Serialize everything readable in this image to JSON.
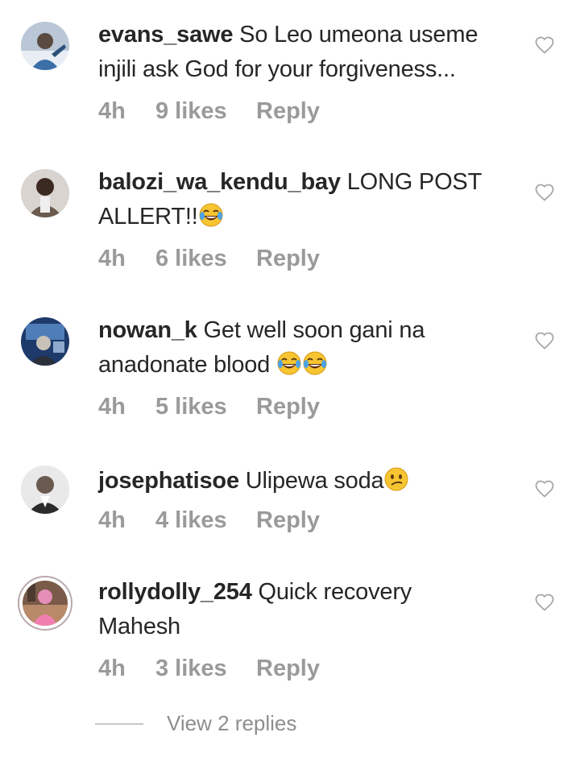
{
  "comments": [
    {
      "username": "evans_sawe",
      "text": "So Leo umeona useme injili ask God for your forgiveness...",
      "line2": "",
      "time": "4h",
      "likes": "9 likes",
      "reply": "Reply",
      "avatar": "avatar-photo"
    },
    {
      "username": "balozi_wa_kendu_bay",
      "text": "LONG POST",
      "line2": "ALLERT!!",
      "time": "4h",
      "likes": "6 likes",
      "reply": "Reply",
      "avatar": "avatar-photo"
    },
    {
      "username": "nowan_k",
      "text": "Get well soon gani na",
      "line2": "anadonate blood",
      "time": "4h",
      "likes": "5 likes",
      "reply": "Reply",
      "avatar": "avatar-photo"
    },
    {
      "username": "josephatisoe",
      "text": "Ulipewa soda",
      "line2": "",
      "time": "4h",
      "likes": "4 likes",
      "reply": "Reply",
      "avatar": "avatar-photo"
    },
    {
      "username": "rollydolly_254",
      "text": "Quick recovery",
      "line2": "Mahesh",
      "time": "4h",
      "likes": "3 likes",
      "reply": "Reply",
      "avatar": "avatar-photo-story-ring"
    }
  ],
  "view_replies": "View 2 replies",
  "icons": {
    "like": "heart-outline-icon",
    "laugh": "face-with-tears-of-joy-emoji",
    "confused": "confused-face-emoji"
  },
  "colors": {
    "text": "#262626",
    "meta": "#9a9a9a",
    "icon": "#a8a8a8"
  }
}
